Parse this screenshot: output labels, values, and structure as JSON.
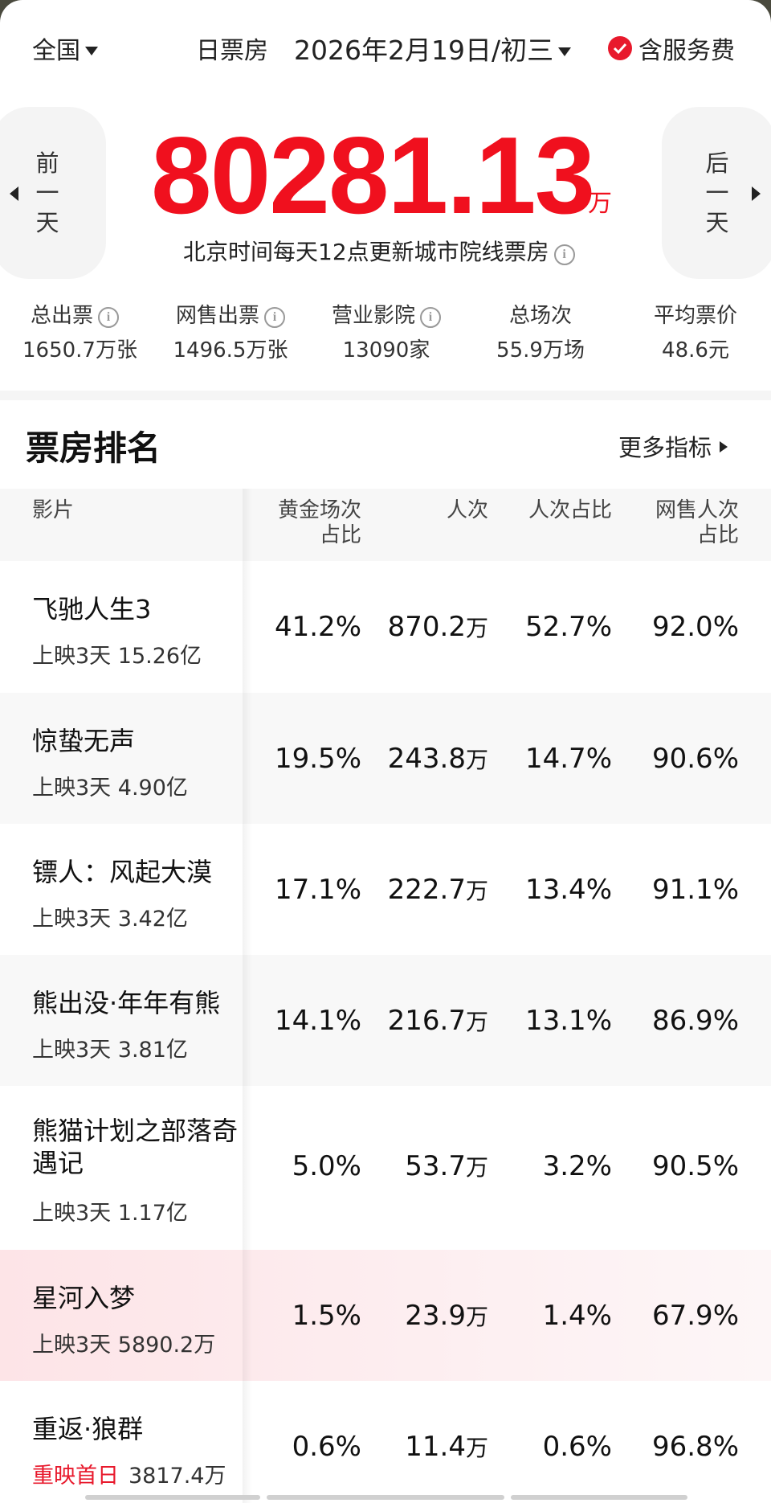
{
  "header": {
    "region": "全国",
    "box_type": "日票房",
    "date": "2026年2月19日/初三",
    "service_fee_label": "含服务费"
  },
  "headline": {
    "prev_day": [
      "前",
      "一",
      "天"
    ],
    "next_day": [
      "后",
      "一",
      "天"
    ],
    "amount": "80281.13",
    "unit": "万",
    "update_note": "北京时间每天12点更新城市院线票房"
  },
  "stats": [
    {
      "label": "总出票",
      "value": "1650.7万张",
      "info": true
    },
    {
      "label": "网售出票",
      "value": "1496.5万张",
      "info": true
    },
    {
      "label": "营业影院",
      "value": "13090家",
      "info": true
    },
    {
      "label": "总场次",
      "value": "55.9万场",
      "info": false
    },
    {
      "label": "平均票价",
      "value": "48.6元",
      "info": false
    }
  ],
  "ranking": {
    "title": "票房排名",
    "more_label": "更多指标",
    "columns": {
      "film": "影片",
      "golden_1": "黄金场次",
      "golden_2": "占比",
      "admissions": "人次",
      "admission_share": "人次占比",
      "online_1": "网售人次",
      "online_2": "占比"
    },
    "rows": [
      {
        "name": "飞驰人生3",
        "tag": "",
        "sub": "上映3天  15.26亿",
        "golden": "41.2%",
        "adm": "870.2",
        "adm_unit": "万",
        "share": "52.7%",
        "online": "92.0%"
      },
      {
        "name": "惊蛰无声",
        "tag": "",
        "sub": "上映3天  4.90亿",
        "golden": "19.5%",
        "adm": "243.8",
        "adm_unit": "万",
        "share": "14.7%",
        "online": "90.6%"
      },
      {
        "name": "镖人：风起大漠",
        "tag": "",
        "sub": "上映3天  3.42亿",
        "golden": "17.1%",
        "adm": "222.7",
        "adm_unit": "万",
        "share": "13.4%",
        "online": "91.1%"
      },
      {
        "name": "熊出没·年年有熊",
        "tag": "",
        "sub": "上映3天  3.81亿",
        "golden": "14.1%",
        "adm": "216.7",
        "adm_unit": "万",
        "share": "13.1%",
        "online": "86.9%"
      },
      {
        "name": "熊猫计划之部落奇遇记",
        "tag": "",
        "sub": "上映3天  1.17亿",
        "golden": "5.0%",
        "adm": "53.7",
        "adm_unit": "万",
        "share": "3.2%",
        "online": "90.5%"
      },
      {
        "name": "星河入梦",
        "tag": "",
        "sub": "上映3天  5890.2万",
        "golden": "1.5%",
        "adm": "23.9",
        "adm_unit": "万",
        "share": "1.4%",
        "online": "67.9%"
      },
      {
        "name": "重返·狼群",
        "tag": "重映首日",
        "sub": "3817.4万",
        "golden": "0.6%",
        "adm": "11.4",
        "adm_unit": "万",
        "share": "0.6%",
        "online": "96.8%"
      }
    ]
  },
  "colors": {
    "accent": "#f0101e",
    "highlight_row": "#fde4e7"
  }
}
